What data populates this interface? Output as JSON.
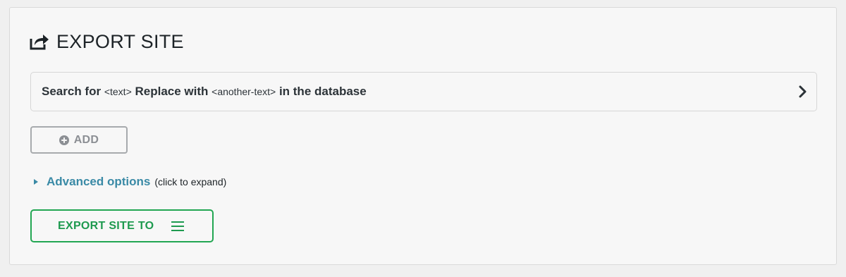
{
  "header": {
    "title": "EXPORT SITE",
    "icon": "export-share-icon"
  },
  "search_replace": {
    "prefix": "Search for",
    "search_token": "<text>",
    "middle": "Replace with",
    "replace_token": "<another-text>",
    "suffix": "in the database",
    "chevron_icon": "chevron-right-icon"
  },
  "add_button": {
    "label": "ADD",
    "icon": "plus-circle-icon"
  },
  "advanced": {
    "link_label": "Advanced options",
    "note": "(click to expand)",
    "icon": "caret-right-icon"
  },
  "export_button": {
    "label": "EXPORT SITE TO",
    "icon": "menu-icon"
  },
  "colors": {
    "accent_green": "#22a652",
    "link_blue": "#3a8aa6",
    "disabled_gray": "#a7aaad"
  }
}
